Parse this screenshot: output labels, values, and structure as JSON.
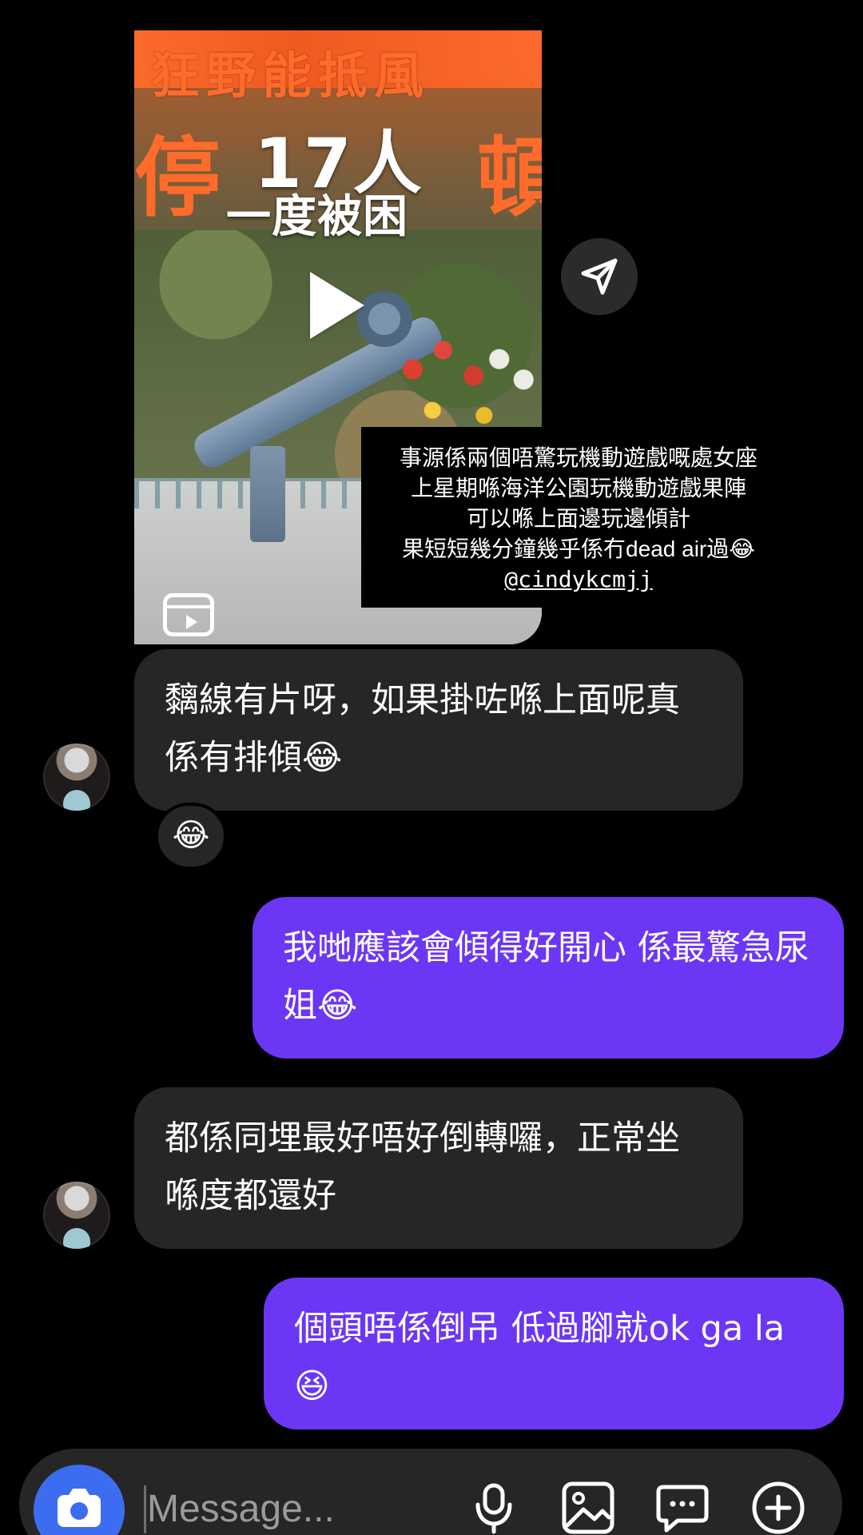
{
  "shared_reel": {
    "overlay_top": "狂野能抵風",
    "overlay_left": "停",
    "overlay_right": "頓",
    "headline_line1": "17人",
    "headline_line2": "一度被困",
    "caption_lines": [
      "事源係兩個唔驚玩機動遊戲嘅處女座",
      "上星期喺海洋公園玩機動遊戲果陣",
      "可以喺上面邊玩邊傾計",
      "果短短幾分鐘幾乎係冇dead air過😂"
    ],
    "caption_handle": "@cindykcmjj"
  },
  "messages": [
    {
      "sender": "incoming",
      "text": "黐線有片呀，如果掛咗喺上面呢真係有排傾😂",
      "reaction": "😂"
    },
    {
      "sender": "outgoing",
      "text": "我哋應該會傾得好開心  係最驚急尿姐😂"
    },
    {
      "sender": "incoming",
      "text": "都係同埋最好唔好倒轉囉，正常坐喺度都還好"
    },
    {
      "sender": "outgoing",
      "text": "個頭唔係倒吊 低過腳就ok ga la😆"
    }
  ],
  "composer": {
    "placeholder": "Message..."
  },
  "icons": {
    "share": "send-icon",
    "camera": "camera-icon",
    "mic": "microphone-icon",
    "gallery": "gallery-icon",
    "sticker": "chat-bubble-icon",
    "plus": "plus-icon"
  },
  "colors": {
    "background": "#000000",
    "incoming_bubble": "#262626",
    "outgoing_bubble": "#6c36f5",
    "camera_button": "#3c6df0"
  }
}
